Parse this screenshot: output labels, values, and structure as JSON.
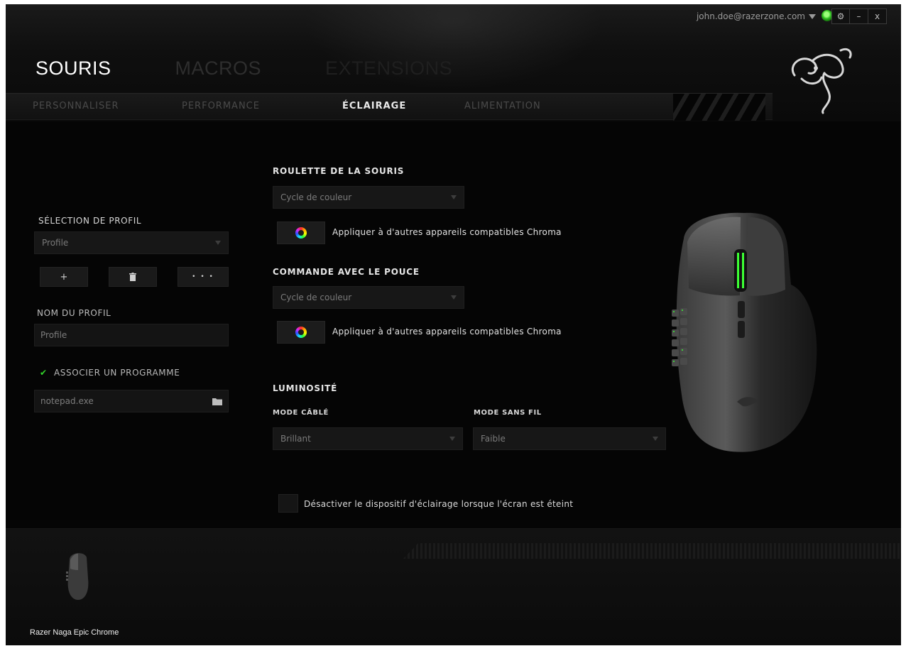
{
  "topbar": {
    "user": "john.doe@razerzone.com",
    "window_buttons": [
      "⚙",
      "–",
      "x"
    ]
  },
  "main_tabs": [
    "SOURIS",
    "MACROS",
    "EXTENSIONS"
  ],
  "sub_tabs": [
    "PERSONNALISER",
    "PERFORMANCE",
    "ÉCLAIRAGE",
    "ALIMENTATION"
  ],
  "left": {
    "profile_selection_label": "SÉLECTION DE PROFIL",
    "profile_select_value": "Profile",
    "profile_buttons": [
      "+",
      "🗑",
      "• • •"
    ],
    "profile_name_label": "NOM DU PROFIL",
    "profile_name_value": "Profile",
    "link_program_label": "ASSOCIER UN PROGRAMME",
    "program_value": "notepad.exe"
  },
  "lighting": {
    "scroll_wheel_title": "ROULETTE DE LA SOURIS",
    "scroll_wheel_value": "Cycle de couleur",
    "apply_chroma_text": "Appliquer à d'autres appareils compatibles Chroma",
    "thumb_title": "COMMANDE AVEC LE POUCE",
    "thumb_value": "Cycle de couleur",
    "brightness_title": "LUMINOSITÉ",
    "wired_label": "MODE CÂBLÉ",
    "wired_value": "Brillant",
    "wireless_label": "MODE SANS FIL",
    "wireless_value": "Faible",
    "screen_off_text": "Désactiver le dispositif d'éclairage lorsque l'écran est éteint"
  },
  "footer": {
    "device_name": "Razer Naga Epic Chrome"
  },
  "colors": {
    "accent_green": "#32d62a",
    "background": "#050505"
  }
}
